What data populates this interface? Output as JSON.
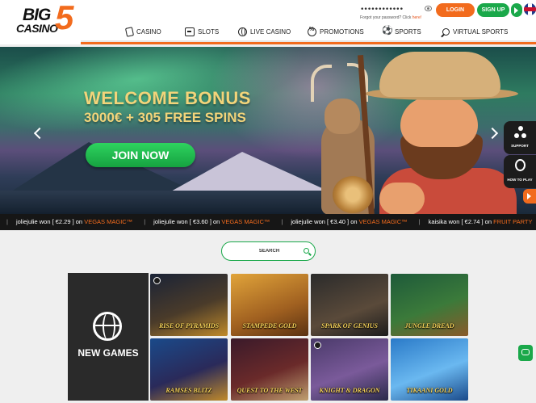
{
  "brand": {
    "logo_big": "BIG",
    "logo_casino": "CASINO",
    "logo_five": "5"
  },
  "account": {
    "password_mask": "••••••••••••",
    "forgot_text": "Forgot your password? Click ",
    "forgot_link": "here!",
    "login_label": "LOGIN",
    "signup_label": "SIGN UP"
  },
  "nav": {
    "items": [
      {
        "label": "CASINO",
        "icon": "cards-icon"
      },
      {
        "label": "SLOTS",
        "icon": "slot-machine-icon"
      },
      {
        "label": "LIVE CASINO",
        "icon": "globe-icon"
      },
      {
        "label": "PROMOTIONS",
        "icon": "promo-icon"
      },
      {
        "label": "SPORTS",
        "icon": "sports-icon"
      },
      {
        "label": "VIRTUAL SPORTS",
        "icon": "virtual-sports-icon"
      }
    ]
  },
  "hero": {
    "title": "WELCOME BONUS",
    "subtitle": "3000€ + 305 FREE SPINS",
    "cta": "JOIN NOW"
  },
  "side_tabs": {
    "support": "SUPPORT",
    "how_to_play": "HOW TO PLAY"
  },
  "ticker": {
    "items": [
      {
        "user": "joliejulie",
        "won": "won [ €2.29 ] on",
        "game": "VEGAS MAGIC™"
      },
      {
        "user": "joliejulie",
        "won": "won [ €3.60 ] on",
        "game": "VEGAS MAGIC™"
      },
      {
        "user": "joliejulie",
        "won": "won [ €3.40 ] on",
        "game": "VEGAS MAGIC™"
      },
      {
        "user": "kaisika",
        "won": "won [ €2.74 ] on",
        "game": "FRUIT PARTY"
      }
    ]
  },
  "search": {
    "placeholder": "SEARCH"
  },
  "games": {
    "section_label": "NEW GAMES",
    "tiles": [
      {
        "name": "RISE OF PYRAMIDS",
        "bg": "linear-gradient(160deg,#1a2336,#4a3b2a 55%,#c08a2a)"
      },
      {
        "name": "STAMPEDE GOLD",
        "bg": "linear-gradient(160deg,#e1a43a,#a06020 60%,#5a3212)"
      },
      {
        "name": "SPARK OF GENIUS",
        "bg": "linear-gradient(160deg,#2b2b2b,#5a4a3a 60%,#1c1c1c)"
      },
      {
        "name": "JUNGLE DREAD",
        "bg": "linear-gradient(160deg,#1e5a3a,#3b7a3a 55%,#8a5a2a)"
      },
      {
        "name": "RAMSES BLITZ",
        "bg": "linear-gradient(160deg,#1a4a8a,#2a2a5a 55%,#c08a2a)"
      },
      {
        "name": "QUEST TO THE WEST",
        "bg": "linear-gradient(160deg,#3a1a2a,#6a2a2a 55%,#c0a070)"
      },
      {
        "name": "KNIGHT & DRAGON",
        "bg": "linear-gradient(160deg,#4a3a6a,#7a5a9a 55%,#2a2a4a)"
      },
      {
        "name": "TIKAANI GOLD",
        "bg": "linear-gradient(160deg,#2a7ac8,#6ab8f0 55%,#1a4a8a)"
      }
    ]
  },
  "colors": {
    "accent": "#f26b1d",
    "primary_green": "#1aa84a",
    "header_bg": "#ffffff",
    "page_bg": "#efefef"
  }
}
